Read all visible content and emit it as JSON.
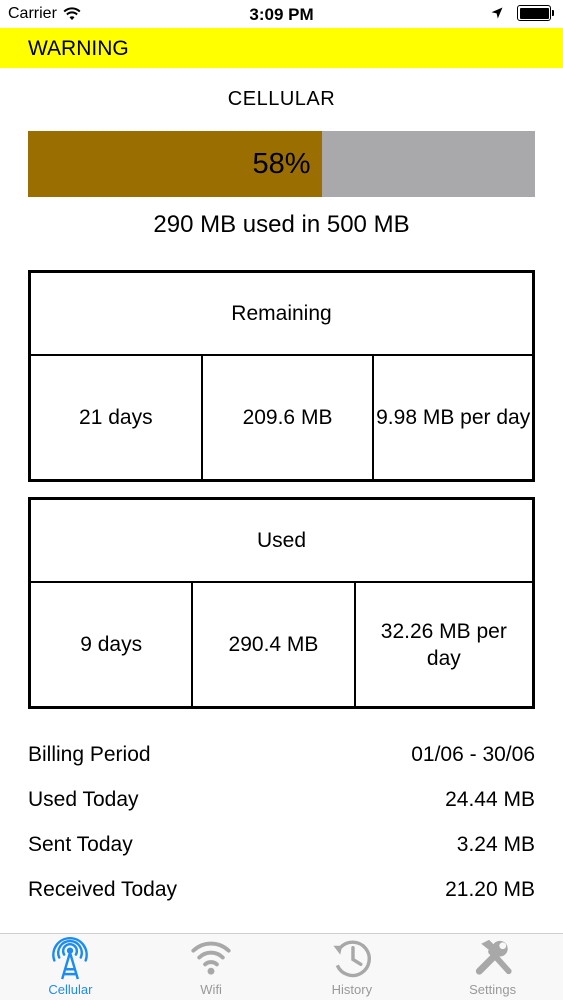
{
  "status_bar": {
    "carrier": "Carrier",
    "time": "3:09 PM",
    "icons": [
      "wifi-icon",
      "location-arrow-icon",
      "battery-icon"
    ]
  },
  "warning": {
    "label": "WARNING",
    "color": "#ffff00"
  },
  "section_title": "CELLULAR",
  "progress": {
    "percent": 58,
    "label": "58%",
    "fill_color": "#9a6e00",
    "track_color": "#a9a9ab"
  },
  "usage_summary": "290 MB used in 500 MB",
  "remaining": {
    "title": "Remaining",
    "days": "21 days",
    "data": "209.6 MB",
    "rate": "9.98 MB per day"
  },
  "used": {
    "title": "Used",
    "days": "9 days",
    "data": "290.4 MB",
    "rate": "32.26 MB per day"
  },
  "stats": [
    {
      "label": "Billing Period",
      "value": "01/06 - 30/06"
    },
    {
      "label": "Used Today",
      "value": "24.44 MB"
    },
    {
      "label": "Sent Today",
      "value": "3.24 MB"
    },
    {
      "label": "Received Today",
      "value": "21.20 MB"
    }
  ],
  "tabs": [
    {
      "label": "Cellular",
      "icon": "antenna-icon",
      "active": true
    },
    {
      "label": "Wifi",
      "icon": "wifi-icon",
      "active": false
    },
    {
      "label": "History",
      "icon": "history-clock-icon",
      "active": false
    },
    {
      "label": "Settings",
      "icon": "tools-icon",
      "active": false
    }
  ],
  "colors": {
    "accent": "#1d8cf0",
    "inactive": "#999999"
  }
}
